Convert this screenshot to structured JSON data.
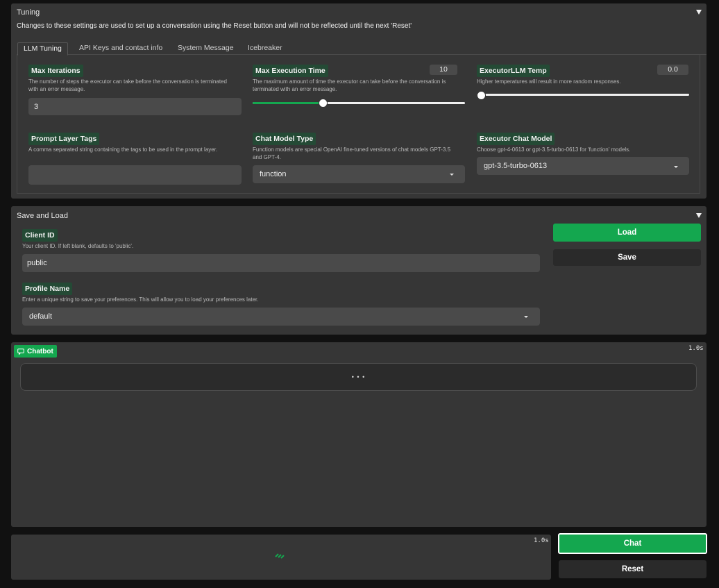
{
  "tuning": {
    "title": "Tuning",
    "subtitle": "Changes to these settings are used to set up a conversation using the Reset button and will not be reflected until the next 'Reset'",
    "tabs": [
      "LLM Tuning",
      "API Keys and contact info",
      "System Message",
      "Icebreaker"
    ],
    "active_tab": "LLM Tuning",
    "max_iterations": {
      "label": "Max Iterations",
      "description": "The number of steps the executor can take before the conversation is terminated with an error message.",
      "value": "3"
    },
    "max_execution_time": {
      "label": "Max Execution Time",
      "description": "The maximum amount of time the executor can take before the conversation is terminated with an error message.",
      "value": "10",
      "slider_fraction": 0.33
    },
    "executor_temp": {
      "label": "ExecutorLLM Temp",
      "description": "Higher temperatures will result in more random responses.",
      "value": "0.0",
      "slider_fraction": 0.0
    },
    "prompt_layer_tags": {
      "label": "Prompt Layer Tags",
      "description": "A comma separated string containing the tags to be used in the prompt layer.",
      "value": ""
    },
    "chat_model_type": {
      "label": "Chat Model Type",
      "description": "Function models are special OpenAI fine-tuned versions of chat models GPT-3.5 and GPT-4.",
      "value": "function"
    },
    "executor_chat_model": {
      "label": "Executor Chat Model",
      "description": "Choose gpt-4-0613 or gpt-3.5-turbo-0613 for 'function' models.",
      "value": "gpt-3.5-turbo-0613"
    }
  },
  "save_load": {
    "title": "Save and Load",
    "client_id": {
      "label": "Client ID",
      "description": "Your client ID. If left blank, defaults to 'public'.",
      "value": "public"
    },
    "profile_name": {
      "label": "Profile Name",
      "description": "Enter a unique string to save your preferences. This will allow you to load your preferences later.",
      "value": "default"
    },
    "load_label": "Load",
    "save_label": "Save"
  },
  "chatbot": {
    "label": "Chatbot",
    "timer": "1.0s",
    "pending_indicator": "• • •"
  },
  "input": {
    "timer": "1.0s"
  },
  "actions": {
    "chat_label": "Chat",
    "reset_label": "Reset"
  },
  "colors": {
    "accent": "#14a74f",
    "label_bg": "#244a35",
    "panel_bg": "#363636",
    "page_bg": "#111111"
  }
}
